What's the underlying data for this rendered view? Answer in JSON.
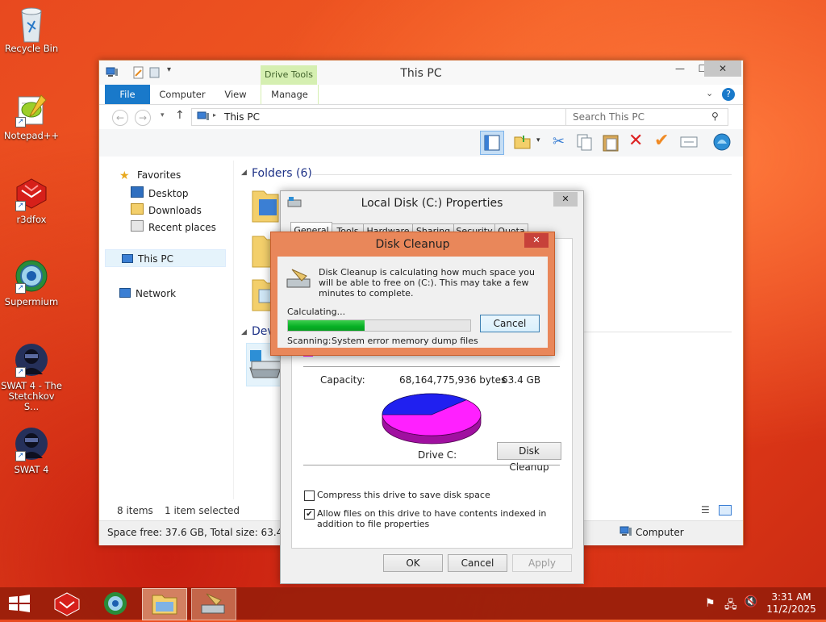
{
  "desktop": {
    "icons": [
      {
        "label": "Recycle Bin"
      },
      {
        "label": "Notepad++"
      },
      {
        "label": "r3dfox"
      },
      {
        "label": "Supermium"
      },
      {
        "label": "SWAT 4 - The Stetchkov S..."
      },
      {
        "label": "SWAT 4"
      }
    ]
  },
  "explorer": {
    "title": "This PC",
    "context_tab_group": "Drive Tools",
    "tabs": [
      "File",
      "Computer",
      "View",
      "Manage"
    ],
    "address": "This PC",
    "search_placeholder": "Search This PC",
    "nav": {
      "favorites": "Favorites",
      "desktop": "Desktop",
      "downloads": "Downloads",
      "recent": "Recent places",
      "thispc": "This PC",
      "network": "Network"
    },
    "folders_header": "Folders (6)",
    "devices_header": "Dev",
    "status_items": "8 items",
    "status_selected": "1 item selected",
    "details_bar": "Space free: 37.6 GB, Total size: 63.4 GB",
    "details_computer": "Computer"
  },
  "props": {
    "title": "Local Disk (C:) Properties",
    "tabs": [
      "General",
      "Tools",
      "Hardware",
      "Sharing",
      "Security",
      "Quota"
    ],
    "capacity_label": "Capacity:",
    "capacity_bytes": "68,164,775,936 bytes",
    "capacity_gb": "63.4 GB",
    "drive_label": "Drive C:",
    "disk_cleanup_button": "Disk Cleanup",
    "compress_label": "Compress this drive to save disk space",
    "compress_checked": false,
    "index_label": "Allow files on this drive to have contents indexed in addition to file properties",
    "index_checked": true,
    "ok": "OK",
    "cancel": "Cancel",
    "apply": "Apply",
    "used_color": "#2020f0",
    "free_color": "#ff20ff"
  },
  "cleanup": {
    "title": "Disk Cleanup",
    "message": "Disk Cleanup is calculating how much space you will be able to free on  (C:). This may take a few minutes to complete.",
    "calculating": "Calculating...",
    "cancel": "Cancel",
    "progress_percent": 42,
    "scanning_label": "Scanning:",
    "scanning_item": "System error memory dump files"
  },
  "taskbar": {
    "time": "3:31 AM",
    "date": "11/2/2025"
  },
  "colors": {
    "accent_blue": "#1979ca",
    "drive_tools_green": "#d5efb1",
    "progress_green": "#06b025"
  }
}
